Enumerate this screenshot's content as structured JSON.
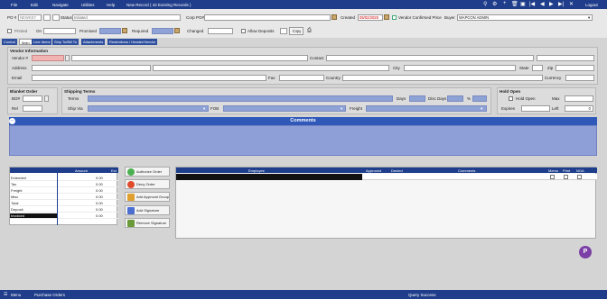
{
  "menu": {
    "file": "File",
    "edit": "Edit",
    "navigate": "Navigate",
    "utilities": "Utilities",
    "help": "Help",
    "record_info": "New Record  ( 42 Existing Records )",
    "logout": "Logout"
  },
  "header": {
    "po_label": "PO #",
    "po_value": "NEWKEY",
    "status_label": "Status",
    "status_value": "Initiated",
    "corp_po_label": "Corp PO#",
    "created_label": "Created",
    "created_value": "05/02/2025",
    "vendor_confirmed_label": "Vendor Confirmed Price",
    "buyer_label": "Buyer",
    "buyer_value": "WAPCON ADMIN",
    "printed_label": "Printed",
    "on_label": "On",
    "promised_label": "Promised",
    "required_label": "Required",
    "changed_label": "Changed",
    "allow_deposit_label": "Allow Deposits",
    "copy_label": "Copy"
  },
  "tabs": [
    {
      "label": "Control"
    },
    {
      "label": "Main"
    },
    {
      "label": "Line Items"
    },
    {
      "label": "Ship To/Bill To"
    },
    {
      "label": "Attachments"
    },
    {
      "label": "Restrictions / Header/Vendor"
    }
  ],
  "vendor": {
    "title": "Vendor Information",
    "vendor_label": "Vendor #",
    "contact_label": "Contact",
    "address_label": "Address",
    "city_label": "City",
    "state_label": "State",
    "zip_label": "Zip",
    "email_label": "Email",
    "fax_label": "Fax",
    "country_label": "Country",
    "currency_label": "Currency"
  },
  "blanket": {
    "title": "Blanket Order",
    "bo_label": "BO#",
    "rel_label": "Rel"
  },
  "shipping": {
    "title": "Shipping Terms",
    "terms_label": "Terms",
    "days_label": "Days",
    "disc_days_label": "Disc Days",
    "pct_label": "%",
    "ship_via_label": "Ship Via",
    "fob_label": "FOB",
    "freight_label": "Freight"
  },
  "hold": {
    "title": "Hold Open",
    "hold_label": "Hold Open",
    "max_label": "Max",
    "expires_label": "Expires",
    "left_label": "Left",
    "left_value": "0"
  },
  "comments": {
    "title": "Comments"
  },
  "amounts": {
    "col_amount": "Amount",
    "col_ext": "Ext",
    "rows": [
      {
        "label": "Extended",
        "value": "0.00"
      },
      {
        "label": "Tax",
        "value": "0.00"
      },
      {
        "label": "Freight",
        "value": "0.00"
      },
      {
        "label": "Misc",
        "value": "0.00"
      },
      {
        "label": "Total",
        "value": "0.00"
      },
      {
        "label": "Deposit",
        "value": "0.00"
      },
      {
        "label": "Invoiced",
        "value": "0.00"
      }
    ]
  },
  "actions": [
    {
      "label": "Authorize Order",
      "color": "#4caf50"
    },
    {
      "label": "Deny Order",
      "color": "#e04b2c"
    },
    {
      "label": "Add Approval Group",
      "color": "#e0a030"
    },
    {
      "label": "Add Signature",
      "color": "#4a6fd0"
    },
    {
      "label": "Remove Signature",
      "color": "#6b9a3a"
    }
  ],
  "employees": {
    "cols": {
      "employee": "Employee",
      "approved": "Approved",
      "denied": "Denied",
      "comments": "Comments",
      "memo": "Memo",
      "print": "Print",
      "noa": "NOA"
    }
  },
  "status": {
    "menu": "Menu",
    "module": "Purchase Orders",
    "message": "Query Success"
  },
  "colors": {
    "navy": "#1f3d8a",
    "field_blue": "#8ea2d6",
    "required_pink": "#f2b3b3",
    "comments_bar": "#2f58b9"
  }
}
